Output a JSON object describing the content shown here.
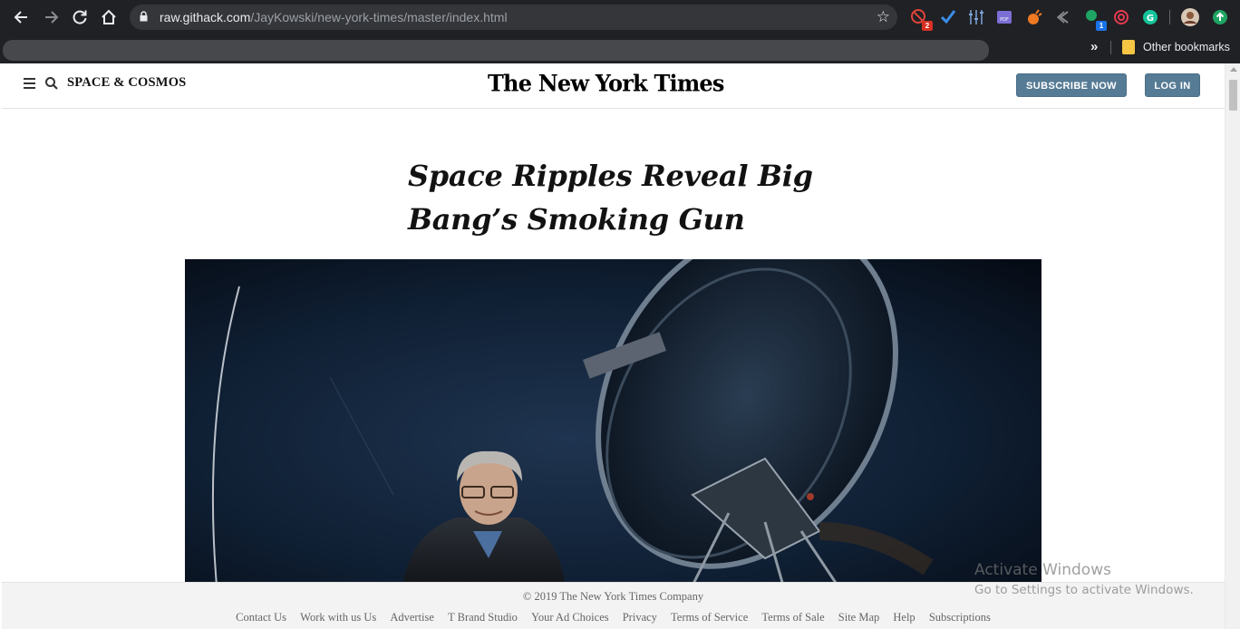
{
  "browser": {
    "url_host": "raw.githack.com",
    "url_path": "/JayKowski/new-york-times/master/index.html",
    "extension_badges": [
      "2",
      "1"
    ],
    "bookmarks_overflow": "»",
    "other_bookmarks_label": "Other bookmarks"
  },
  "header": {
    "section": "SPACE & COSMOS",
    "logo": "The New York Times",
    "subscribe_label": "SUBSCRIBE NOW",
    "login_label": "LOG IN"
  },
  "article": {
    "headline_line1": "Space Ripples Reveal Big",
    "headline_line2": "Bang’s Smoking Gun"
  },
  "footer": {
    "copyright": "© 2019 The New York Times Company",
    "links": [
      "Contact Us",
      "Work with us Us",
      "Advertise",
      "T Brand Studio",
      "Your Ad Choices",
      "Privacy",
      "Terms of Service",
      "Terms of Sale",
      "Site Map",
      "Help",
      "Subscriptions"
    ]
  },
  "watermark": {
    "title": "Activate Windows",
    "subtitle": "Go to Settings to activate Windows."
  },
  "colors": {
    "chrome_bg": "#202124",
    "button_bg": "#567b95",
    "footer_bg": "#f3f3f3",
    "text": "#121212"
  }
}
